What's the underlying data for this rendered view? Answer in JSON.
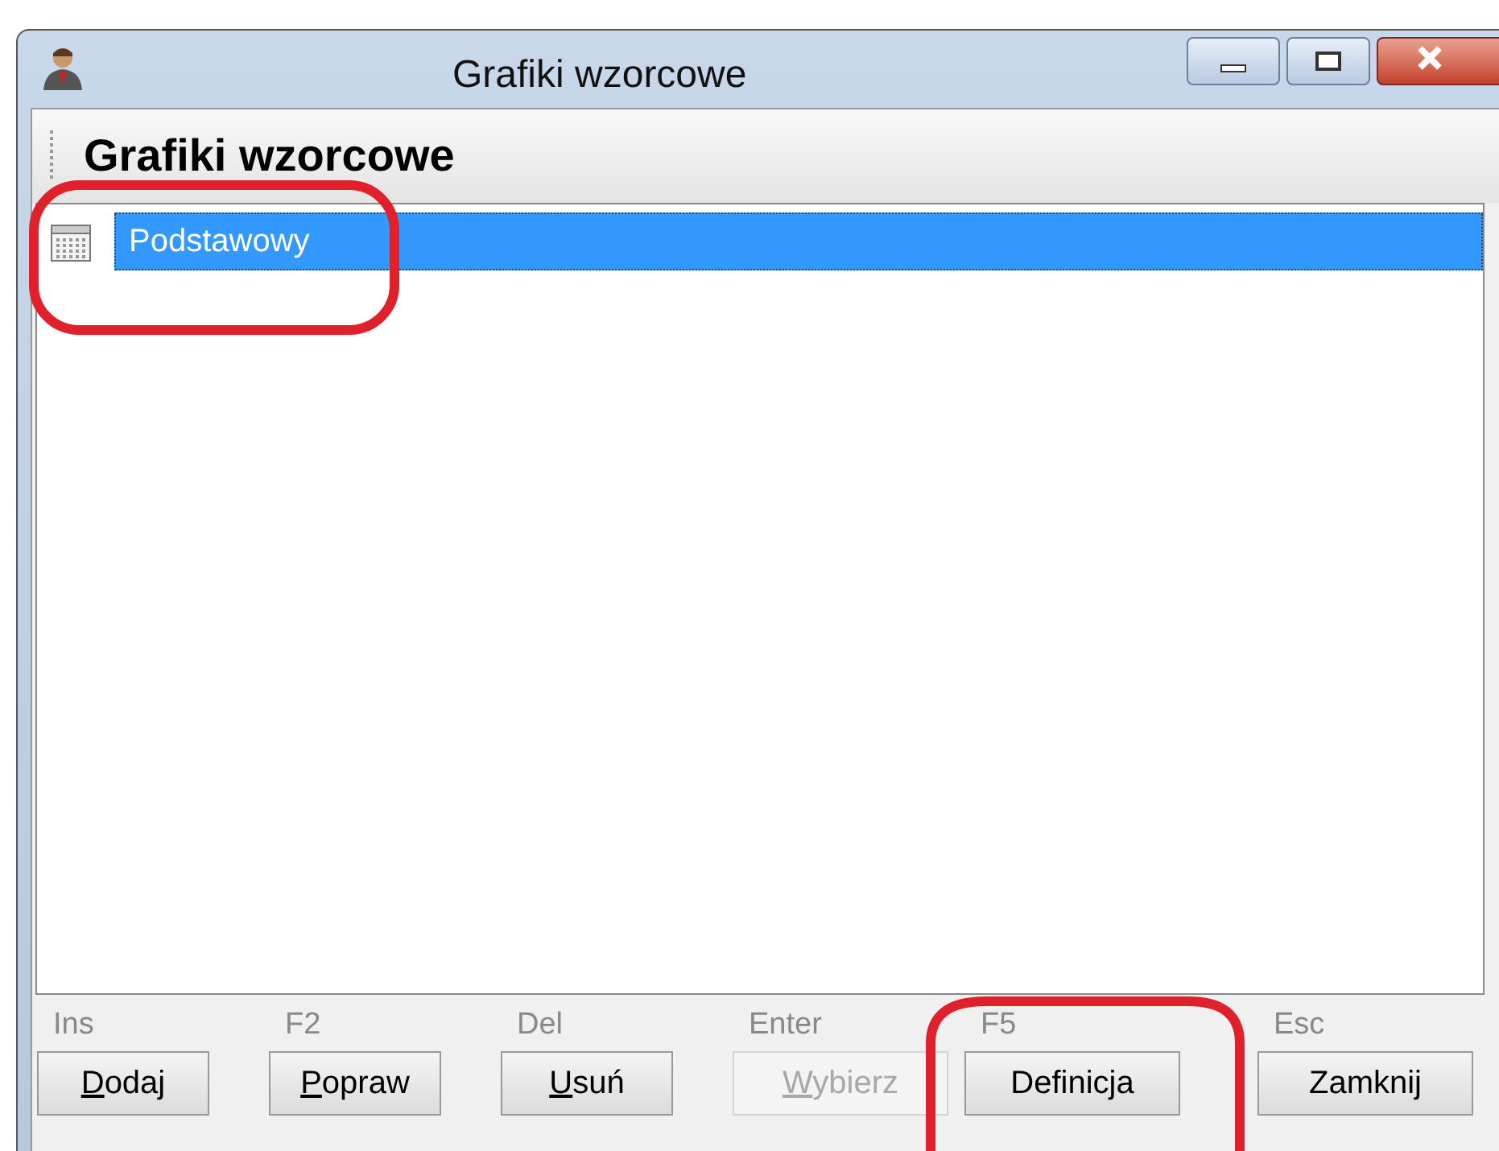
{
  "window": {
    "title": "Grafiki wzorcowe"
  },
  "header": {
    "title": "Grafiki wzorcowe"
  },
  "list": {
    "items": [
      {
        "label": "Podstawowy",
        "selected": true
      }
    ]
  },
  "buttons": [
    {
      "hotkey": "Ins",
      "mnemonic": "D",
      "rest": "odaj",
      "disabled": false
    },
    {
      "hotkey": "F2",
      "mnemonic": "P",
      "rest": "opraw",
      "disabled": false
    },
    {
      "hotkey": "Del",
      "mnemonic": "U",
      "rest": "suń",
      "disabled": false
    },
    {
      "hotkey": "Enter",
      "mnemonic": "W",
      "rest": "ybierz",
      "disabled": true
    },
    {
      "hotkey": "F5",
      "rest": "Definicja",
      "disabled": false
    },
    {
      "hotkey": "Esc",
      "rest": "Zamknij",
      "disabled": false
    }
  ]
}
